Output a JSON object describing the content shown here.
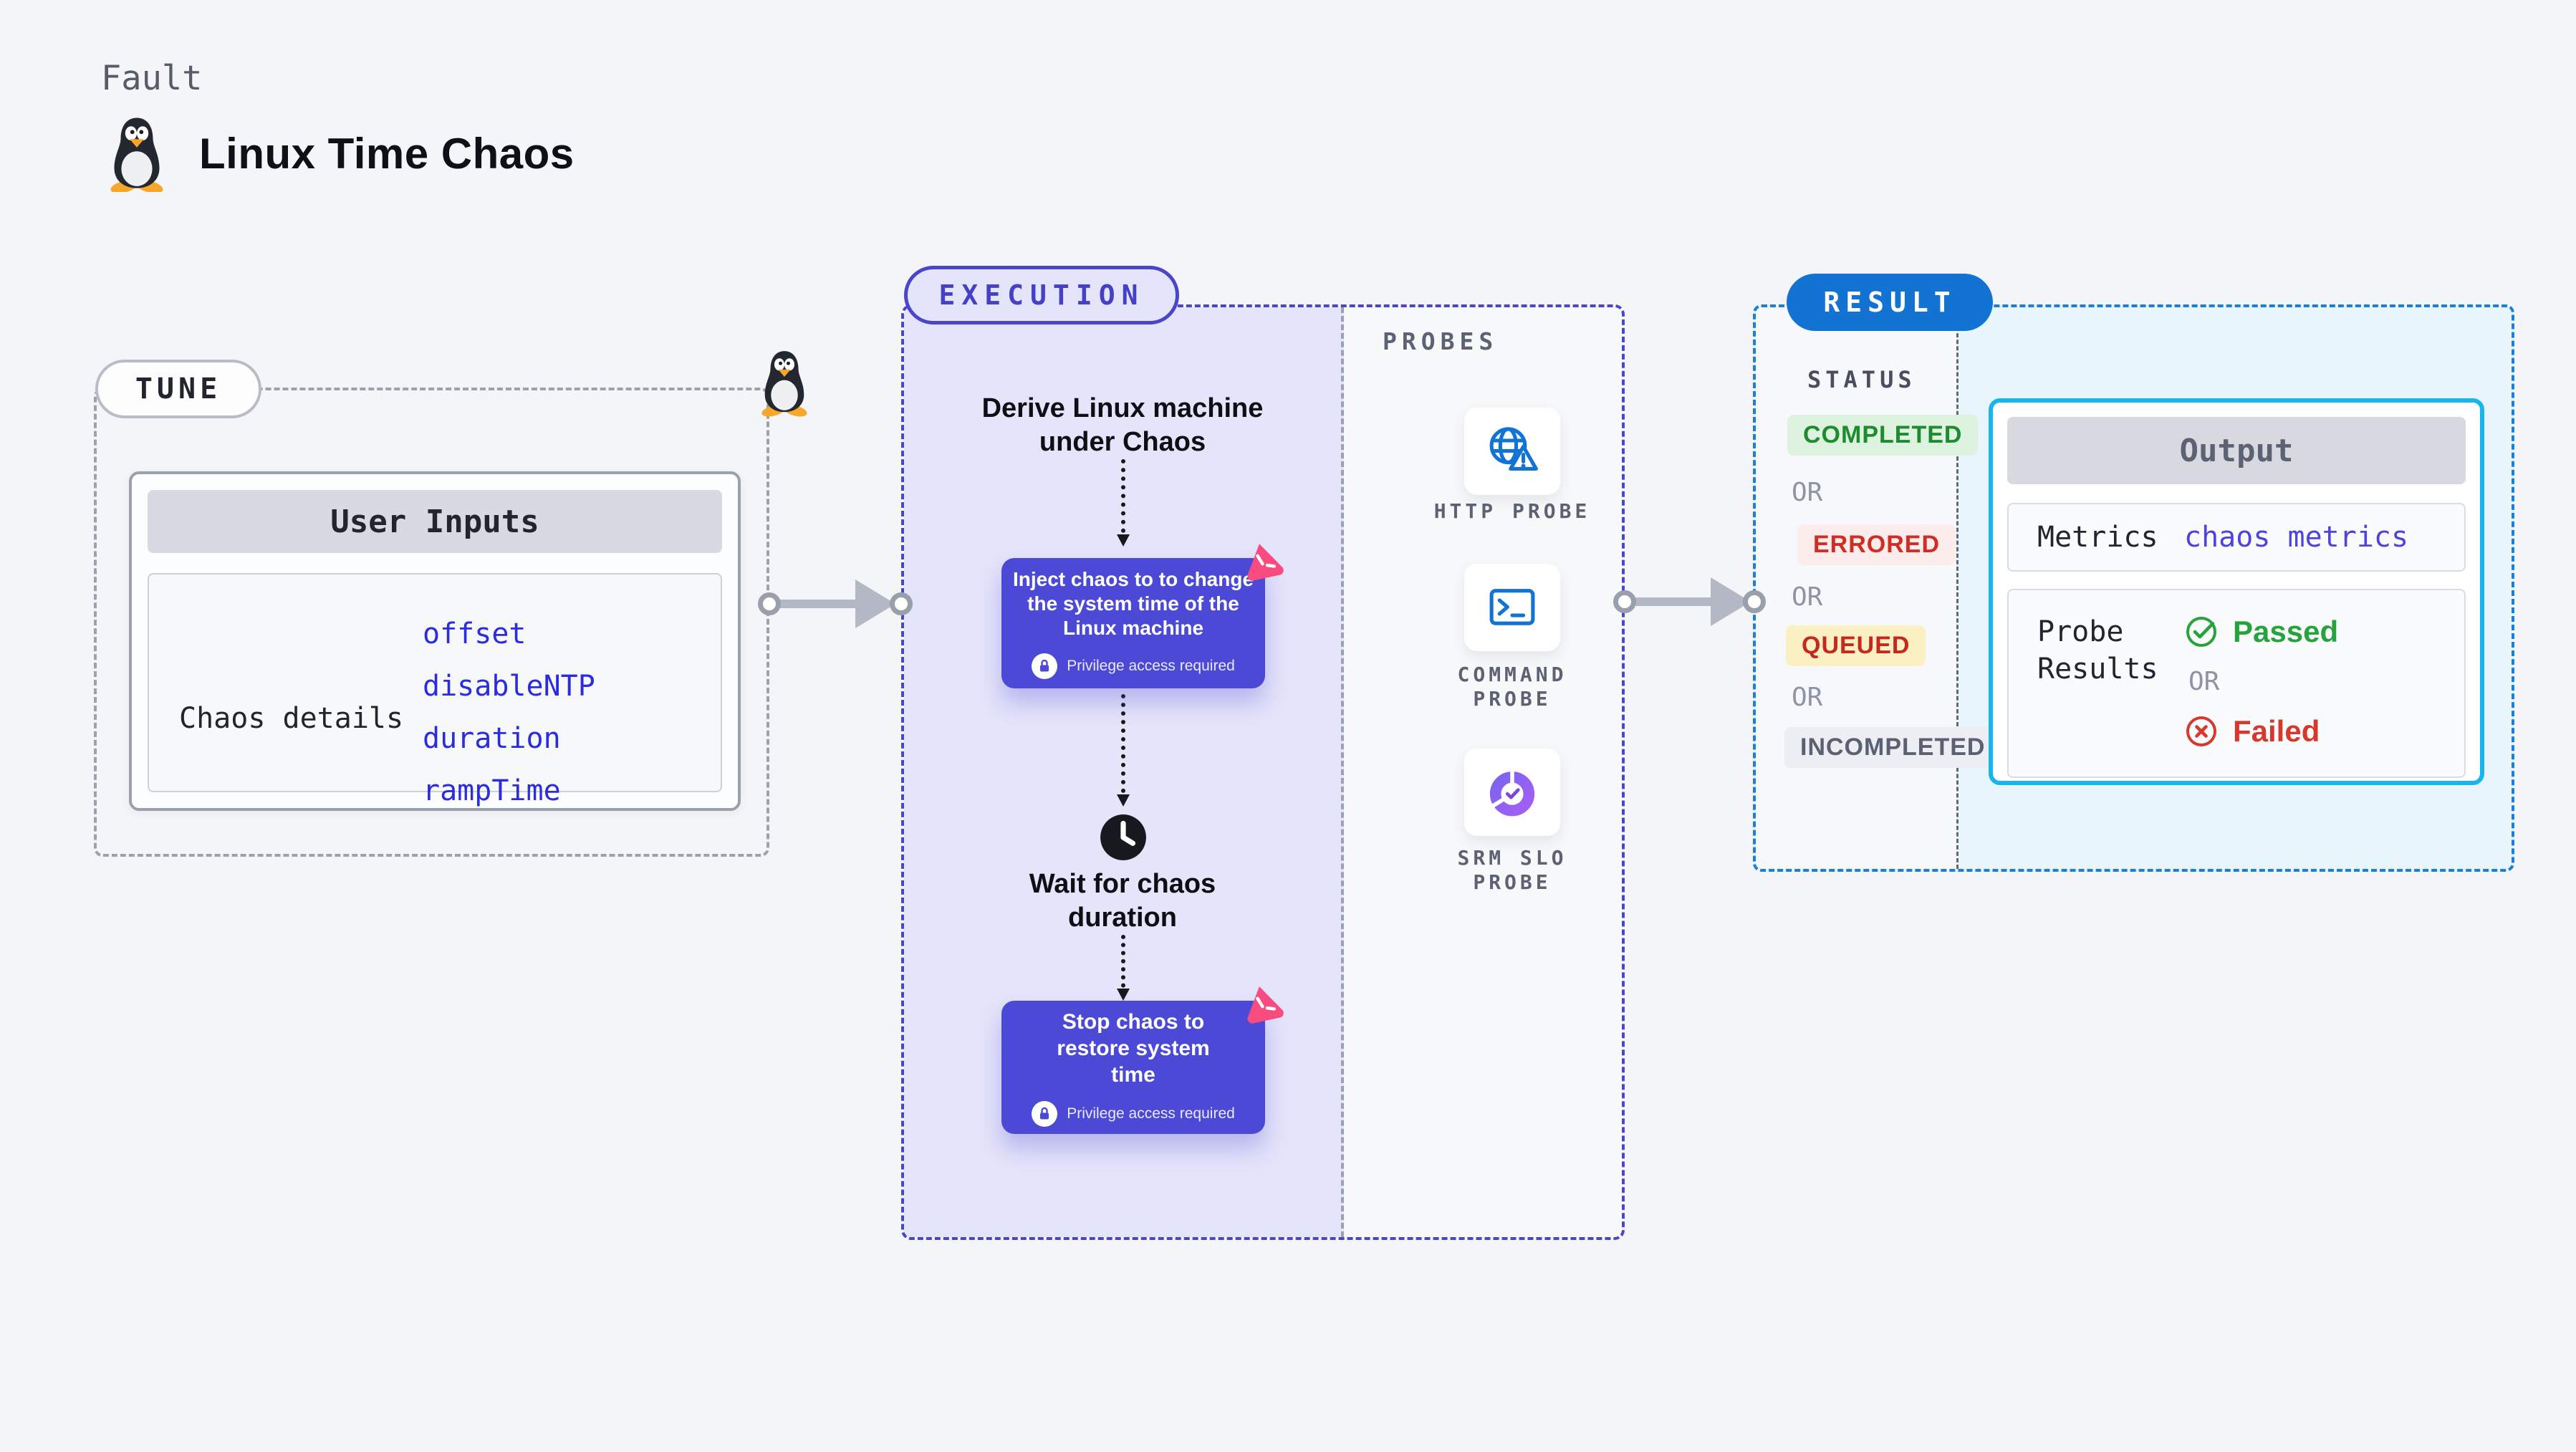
{
  "header": {
    "kicker": "Fault",
    "title": "Linux Time Chaos",
    "icon": "tux-penguin-icon"
  },
  "tune": {
    "label": "TUNE",
    "user_inputs_title": "User Inputs",
    "row_label": "Chaos details",
    "params": [
      "offset",
      "disableNTP",
      "duration",
      "rampTime"
    ]
  },
  "execution": {
    "label": "EXECUTION",
    "derive_text": "Derive Linux machine under Chaos",
    "inject_text": "Inject chaos to to change the system time of the Linux machine",
    "privilege_note": "Privilege access required",
    "wait_text": "Wait for chaos duration",
    "stop_text": "Stop chaos to restore system time"
  },
  "probes": {
    "label": "PROBES",
    "items": [
      {
        "icon": "globe-alert-icon",
        "label": "HTTP PROBE"
      },
      {
        "icon": "terminal-icon",
        "label": "COMMAND PROBE"
      },
      {
        "icon": "slo-donut-icon",
        "label": "SRM SLO PROBE"
      }
    ]
  },
  "result": {
    "label": "RESULT",
    "status_heading": "STATUS",
    "or_separator": "OR",
    "statuses": [
      {
        "label": "COMPLETED",
        "fg": "#1c8c2e",
        "bg": "#def3df"
      },
      {
        "label": "ERRORED",
        "fg": "#d02e24",
        "bg": "#fdecec"
      },
      {
        "label": "QUEUED",
        "fg": "#c5281c",
        "bg": "#fbf0c4"
      },
      {
        "label": "INCOMPLETED",
        "fg": "#5b6173",
        "bg": "#edeef4"
      }
    ],
    "output": {
      "title": "Output",
      "metrics_label": "Metrics",
      "metrics_link": "chaos metrics",
      "probe_results_label": "Probe Results",
      "passed_label": "Passed",
      "or_separator": "OR",
      "failed_label": "Failed"
    }
  },
  "colors": {
    "page_bg": "#f4f5f8",
    "lavender_bg": "#e4e4fa",
    "indigo_accent": "#4b49d6",
    "exec_border": "#4a45c9",
    "tune_dash": "#9ba1ad",
    "link_blue": "#2b2be0",
    "probe_icon_blue": "#1173d4",
    "srm_purple": "#8a5cf2",
    "result_blue": "#1273d3",
    "result_dash": "#1b7fd8",
    "cyan_border": "#17b5ec",
    "cyan_bg": "#e8f5fd",
    "passed_green": "#27a33b",
    "failed_red": "#d6392b",
    "chaos_pink": "#fa4b80",
    "arrow_gray": "#b4b8c4"
  }
}
